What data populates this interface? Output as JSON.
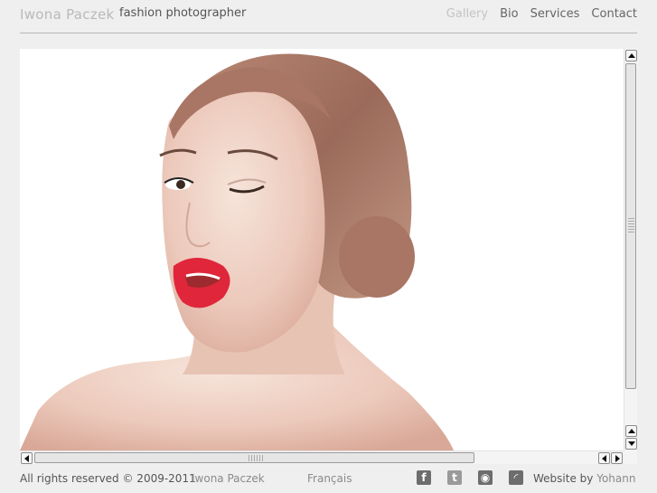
{
  "header": {
    "brand_name": "Iwona Paczek",
    "brand_tagline": "fashion photographer",
    "nav": [
      "Gallery",
      "Bio",
      "Services",
      "Contact"
    ]
  },
  "viewer": {
    "photo": "portrait of a winking woman with red lips",
    "vertical_scroll_position": 0,
    "horizontal_scroll_position": 0
  },
  "footer": {
    "copyright": "All rights reserved © 2009-2011",
    "owner": "Iwona Paczek",
    "language": "Français",
    "social_icons": [
      "facebook-icon",
      "twitter-icon",
      "flickr-icon",
      "rss-icon"
    ],
    "website_label": "Website by",
    "website_author": "Yohann"
  },
  "colors": {
    "background": "#efefef",
    "active_nav": "#c4c4c4",
    "text": "#555555"
  }
}
